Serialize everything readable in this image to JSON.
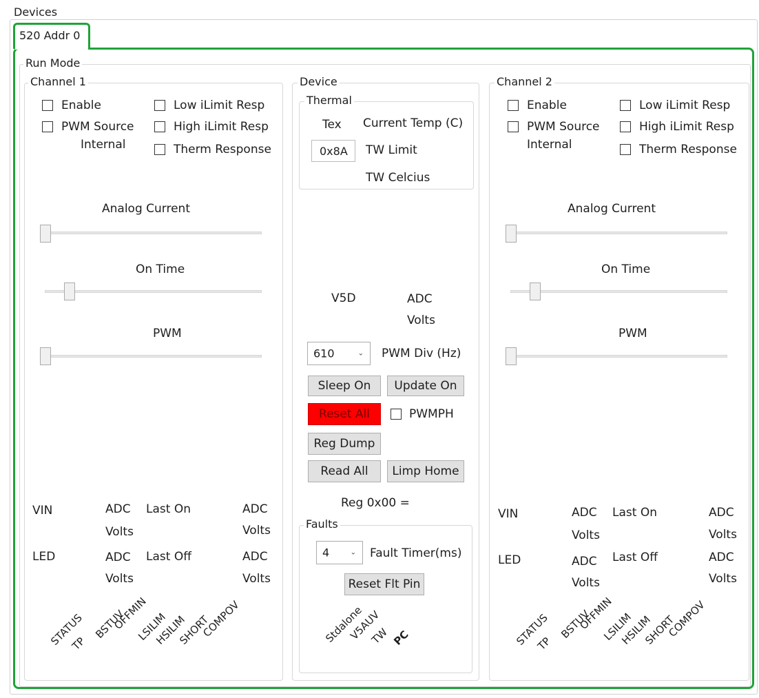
{
  "devices_label": "Devices",
  "tab_label": "520 Addr 0",
  "run_mode_label": "Run Mode",
  "channel1": {
    "title": "Channel 1",
    "enable": "Enable",
    "pwm_source_line1": "PWM Source",
    "pwm_source_line2": "Internal",
    "low_ilimit": "Low iLimit Resp",
    "high_ilimit": "High iLimit Resp",
    "therm_response": "Therm Response",
    "analog_current": "Analog Current",
    "on_time": "On Time",
    "pwm": "PWM",
    "vin": "VIN",
    "led": "LED",
    "adc": "ADC",
    "volts": "Volts",
    "last_on": "Last On",
    "last_off": "Last Off",
    "status_flags": [
      "STATUS",
      "TP",
      "BSTUV",
      "OFFMIN",
      "LSILIM",
      "HSILIM",
      "SHORT",
      "COMPOV"
    ]
  },
  "channel2": {
    "title": "Channel 2",
    "enable": "Enable",
    "pwm_source_line1": "PWM Source",
    "pwm_source_line2": "Internal",
    "low_ilimit": "Low iLimit Resp",
    "high_ilimit": "High iLimit Resp",
    "therm_response": "Therm Response",
    "analog_current": "Analog Current",
    "on_time": "On Time",
    "pwm": "PWM",
    "vin": "VIN",
    "led": "LED",
    "adc": "ADC",
    "volts": "Volts",
    "last_on": "Last On",
    "last_off": "Last Off",
    "status_flags": [
      "STATUS",
      "TP",
      "BSTUV",
      "OFFMIN",
      "LSILIM",
      "HSILIM",
      "SHORT",
      "COMPOV"
    ]
  },
  "device": {
    "title": "Device",
    "thermal_title": "Thermal",
    "tex": "Tex",
    "tex_value": "0x8A",
    "current_temp": "Current Temp (C)",
    "tw_limit": "TW Limit",
    "tw_celcius": "TW Celcius",
    "v5d": "V5D",
    "adc": "ADC",
    "volts": "Volts",
    "pwm_div_value": "610",
    "pwm_div_label": "PWM Div (Hz)",
    "sleep_on": "Sleep On",
    "update_on": "Update On",
    "reset_all": "Reset All",
    "pwmph": "PWMPH",
    "reg_dump": "Reg Dump",
    "read_all": "Read All",
    "limp_home": "Limp Home",
    "reg_readout": "Reg 0x00 =",
    "faults_title": "Faults",
    "fault_timer_value": "4",
    "fault_timer_label": "Fault Timer(ms)",
    "reset_flt_pin": "Reset Flt Pin",
    "fault_flags": [
      "Stdalone",
      "V5AUV",
      "TW",
      "PC"
    ]
  },
  "colors": {
    "focus_border": "#1fa339",
    "reset_all_bg": "#ff0000",
    "button_bg": "#e1e1e1"
  },
  "sliders": {
    "analog_current_level": 0,
    "on_time_level": 0.1,
    "pwm_level": 0
  }
}
